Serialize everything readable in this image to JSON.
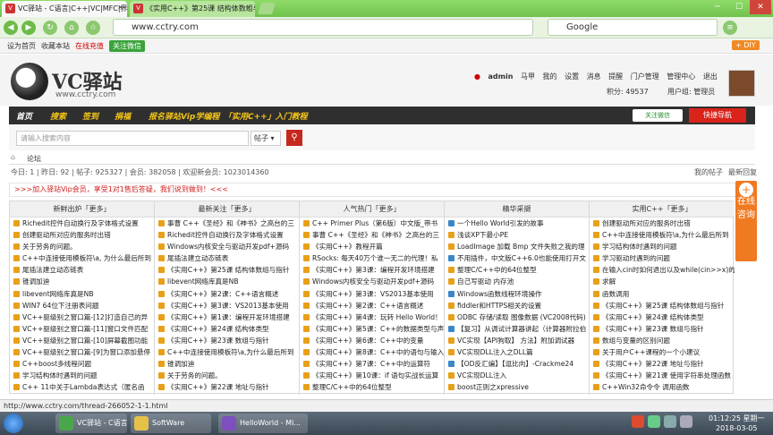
{
  "browser": {
    "tabs": [
      {
        "title": "VC驿站 - C语言|C++|VC|MFC|界"
      },
      {
        "title": "《实用C++》第25课 结构体数组与"
      }
    ],
    "url": "www.cctry.com",
    "search_engine": "Google",
    "favbar": {
      "home": "设为首页",
      "bookmark": "收藏本站",
      "recharge": "在线充值",
      "wechat": "关注微信",
      "diy": "+ DIY"
    }
  },
  "site": {
    "logo": "VC驿站",
    "logo_url": "www.cctry.com",
    "user": {
      "name": "admin",
      "horse": "马甲",
      "mine": "我的",
      "settings": "设置",
      "messages": "消息",
      "remind": "提醒",
      "portal_manage": "门户管理",
      "manage_center": "管理中心",
      "logout": "退出",
      "points": "积分: 49537",
      "group": "用户组: 管理员"
    },
    "nav": [
      "首页",
      "搜索",
      "签到",
      "捐福",
      "报名驿站Vip学编程",
      "「实用C++」入门教程"
    ],
    "nav_wechat": "关注微信",
    "nav_quick": "快捷导航",
    "search_placeholder": "请输入搜索内容",
    "search_type": "帖子",
    "breadcrumb": "论坛",
    "stats": "今日: 1 | 昨日: 92 | 帖子: 925327 | 会员: 382058 | 欢迎新会员: 1023014360",
    "my_posts": "我的帖子",
    "latest": "最新回复",
    "banner": ">>>加入驿站Vip会员，享受1对1售后答疑，我们说到做到！<<<",
    "consult": "在线咨询"
  },
  "columns": [
    {
      "title": "新鲜出炉「更多」",
      "items": [
        "Richedit控件自动换行及字体格式设置",
        "创建驱动所对应的服务时出错",
        "关于劳务的问题。",
        "C++中连接使用模板符\\a, 为什么最后所到",
        "尾插法建立动态链表",
        "锥调加迪",
        "libevent网络库真是NB",
        "WIN7 64位下注册表问题",
        "VC++驱级别之窗口篇-[12]打造自己的异",
        "VC++驱级别之窗口篇-[11]窗口文件匹配",
        "VC++驱级别之窗口篇-[10]屏幕截图功能",
        "VC++驱级别之窗口篇-[9]为窗口添加悬停",
        "C++boost多线程问题",
        "学习结构体时遇到的问题",
        "C++ 11中关于Lambda表达式（匿名函"
      ]
    },
    {
      "title": "最新关注「更多」",
      "items": [
        "事曹 C++《圣经》和《神书》之高台的三",
        "Richedit控件自动换行及字体格式设置",
        "Windows内核安全与驱动开发pdf+源码",
        "尾插法建立动态链表",
        "《实用C++》第25课 结构体数组与指针",
        "libevent网络库真是NB",
        "《实用C++》第2课：C++语言概述",
        "《实用C++》第3课：VS2013基本使用",
        "《实用C++》第1课：编程开发环境搭建",
        "《实用C++》第24课 结构体类型",
        "《实用C++》第23课 数组与指针",
        "C++中连接使用模板符\\a,为什么最后所到",
        "锥调加迪",
        "关于劳务的问题。",
        "《实用C++》第22课 地址与指针"
      ]
    },
    {
      "title": "人气热门「更多」",
      "items": [
        "C++ Primer Plus（第6版）中文版_带书",
        "事曹 C++《圣经》和《神书》之高台的三",
        "《实用C++》教程开篇",
        "RSocks: 每天40万个谁一无二的代理！私",
        "《实用C++》第3课：编程开发环境搭建",
        "Windows内核安全与驱动开发pdf+源码",
        "《实用C++》第3课：VS2013基本使用",
        "《实用C++》第2课：C++语言概述",
        "《实用C++》第4课：玩转 Hello World！",
        "《实用C++》第5课：C++的数据类型与声",
        "《实用C++》第6课：C++中的变量",
        "《实用C++》第8课：C++中的语句与输入输",
        "《实用C++》第7课：C++中的运算符",
        "《实用C++》第10课：if 语句实战长运算",
        "整理C/C++中的64位整型"
      ]
    },
    {
      "title": "精华采撷",
      "items": [
        "一个Hello World引发的故事",
        "浅谈XP下最小PE",
        "LoadImage 加载 Bmp 文件失败之我的理",
        "不用插件，中文版C++6.0也能使用打开文",
        "整理C/C++中的64位整型",
        "自己写驱动 内存池",
        "Windows函数线程环境操作",
        "fiddler和HTTPS相关的设置",
        "ODBC 存储/读取 图像数据 (VC2008代码)",
        "【复习】从调试计算器讲起（计算器附拉伯",
        "VC实现【API狗取】 方法】附加调试器",
        "VC实现DLL注入之DLL篇",
        "【OD反汇编】【逗比向】-Crackme24",
        "VC实现DLL注入",
        "boost正则之xpressive"
      ]
    },
    {
      "title": "实用C++「更多」",
      "items": [
        "创建驱动所对应的服务时出错",
        "C++中连接使用模板符\\a,为什么最后所到",
        "学习结构体时遇到的问题",
        "学习驱动时遇到的问题",
        "在输入cin时如何退出以及while(cin>>x)的",
        "求解",
        "函数调用",
        "《实用C++》第25课 结构体数组与指针",
        "《实用C++》第24课 结构体类型",
        "《实用C++》第23课 数组与指针",
        "数组与变量的区别问题",
        "关于用户C++课程的一个小建议",
        "《实用C++》第22课 地址与指针",
        "《实用C++》第21课 使用字符串处理函数",
        "C++Win32命令令 调用函数"
      ]
    }
  ],
  "status": "http://www.cctry.com/thread-266052-1-1.html",
  "taskbar": {
    "apps": [
      "VC驿站 - C语言...",
      "SoftWare",
      "HelloWorld - Mi..."
    ],
    "time": "01:12:25 星期一",
    "date": "2018-03-05"
  },
  "colors": {
    "accent": "#c5271f",
    "nav_bg": "#2f2f2f",
    "nav_text": "#f5c518",
    "browser_green": "#6fc24c"
  }
}
